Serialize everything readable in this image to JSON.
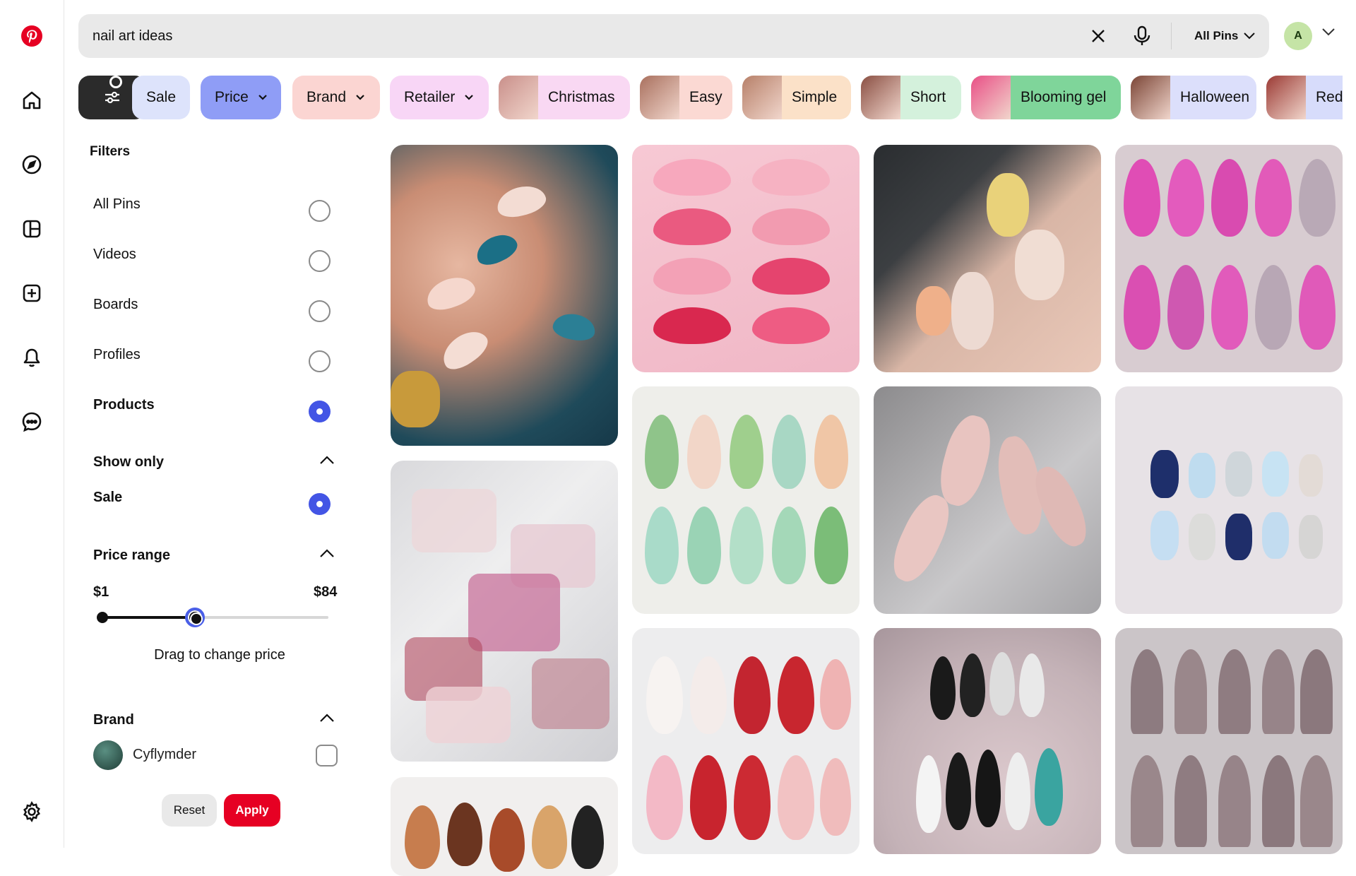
{
  "search": {
    "query": "nail art ideas",
    "scope_label": "All Pins",
    "avatar_initial": "A"
  },
  "chips": [
    {
      "label": "Sale",
      "bg": "#dde3fb",
      "dropdown": false
    },
    {
      "label": "Price",
      "bg": "#8f9df6",
      "dropdown": true
    },
    {
      "label": "Brand",
      "bg": "#fbd5d2",
      "dropdown": true
    },
    {
      "label": "Retailer",
      "bg": "#f8d6f6",
      "dropdown": true
    },
    {
      "label": "Christmas",
      "bg": "#f9d8f3",
      "thumb": "#c98f8a"
    },
    {
      "label": "Easy",
      "bg": "#fbd9d3",
      "thumb": "#a9705e"
    },
    {
      "label": "Simple",
      "bg": "#fbe1c8",
      "thumb": "#b78069"
    },
    {
      "label": "Short",
      "bg": "#d4f1dc",
      "thumb": "#8a4f43"
    },
    {
      "label": "Blooming gel",
      "bg": "#7fd59a",
      "thumb": "#e94f86"
    },
    {
      "label": "Halloween",
      "bg": "#dcdffb",
      "thumb": "#7b4536"
    },
    {
      "label": "Red",
      "bg": "#d7dcfb",
      "thumb": "#9b3a34"
    }
  ],
  "filters": {
    "title": "Filters",
    "pin_types": [
      {
        "label": "All Pins",
        "selected": false
      },
      {
        "label": "Videos",
        "selected": false
      },
      {
        "label": "Boards",
        "selected": false
      },
      {
        "label": "Profiles",
        "selected": false
      },
      {
        "label": "Products",
        "selected": true
      }
    ],
    "show_only": {
      "title": "Show only",
      "option": "Sale",
      "selected": true
    },
    "price_range": {
      "title": "Price range",
      "min": "$1",
      "max": "$84",
      "hint": "Drag to change price"
    },
    "brand": {
      "title": "Brand",
      "items": [
        {
          "name": "Cyflymder",
          "checked": false
        }
      ]
    },
    "reset_label": "Reset",
    "apply_label": "Apply"
  },
  "colors": {
    "brand_red": "#e60023",
    "selected_blue": "#4355e5"
  },
  "pins": [
    {
      "name": "pin-blue-floral-almond"
    },
    {
      "name": "pin-red-pink-wave-press-ons"
    },
    {
      "name": "pin-3d-flower-nails"
    },
    {
      "name": "pin-pink-heart-bow-set"
    },
    {
      "name": "pin-azure-press-on-boxes"
    },
    {
      "name": "pin-green-garden-set"
    },
    {
      "name": "pin-chrome-bow-nude"
    },
    {
      "name": "pin-twice-blue-set"
    },
    {
      "name": "pin-snoopy-set"
    },
    {
      "name": "pin-dark-graphic-set"
    },
    {
      "name": "pin-chrome-stiletto-set"
    },
    {
      "name": "pin-tortoise-set"
    }
  ]
}
